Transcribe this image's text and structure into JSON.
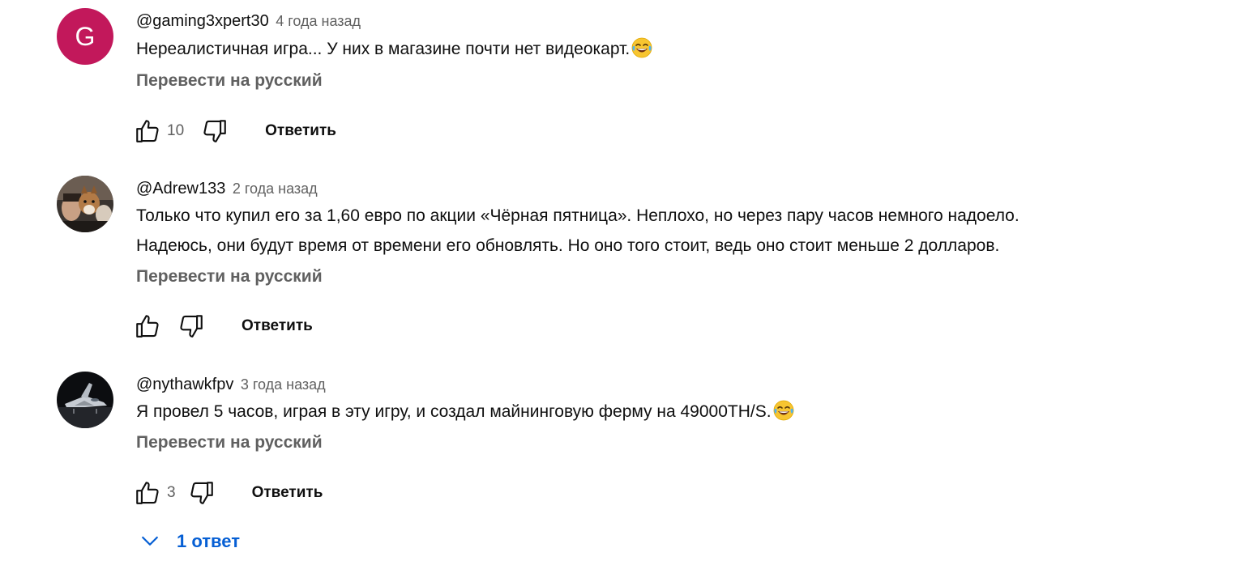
{
  "comments": [
    {
      "author": "@gaming3xpert30",
      "time": "4 года назад",
      "avatar_letter": "G",
      "avatar_color": "#c2185b",
      "text": "Нереалистичная игра... У них в магазине почти нет видеокарт.",
      "emoji": "face-with-tears-of-joy",
      "translate": "Перевести на русский",
      "likes": "10",
      "reply": "Ответить"
    },
    {
      "author": "@Adrew133",
      "time": "2 года назад",
      "avatar_kind": "photo-dogs",
      "text_lines": [
        "Только что купил его за 1,60 евро по акции «Чёрная пятница». Неплохо, но через пару часов немного надоело.",
        "Надеюсь, они будут время от времени его обновлять. Но оно того стоит, ведь оно стоит меньше 2 долларов."
      ],
      "translate": "Перевести на русский",
      "likes": "",
      "reply": "Ответить"
    },
    {
      "author": "@nythawkfpv",
      "time": "3 года назад",
      "avatar_kind": "photo-jet",
      "text": "Я провел 5 часов, играя в эту игру, и создал майнинговую ферму на 49000TH/S.",
      "emoji": "face-with-tears-of-joy",
      "translate": "Перевести на русский",
      "likes": "3",
      "reply": "Ответить"
    }
  ],
  "replies_toggle": "1 ответ",
  "colors": {
    "link_blue": "#065fd4",
    "secondary_text": "#606060",
    "primary_text": "#0f0f0f"
  }
}
